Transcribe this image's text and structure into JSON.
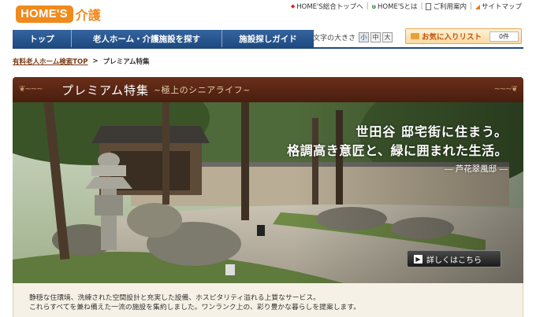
{
  "header": {
    "logo_home": "HOME'S",
    "logo_kaigo": "介護",
    "links": [
      "HOME'S総合トップへ",
      "HOME'Sとは",
      "ご利用案内",
      "サイトマップ"
    ]
  },
  "nav": {
    "items": [
      "トップ",
      "老人ホーム・介護施設を探す",
      "施設探しガイド"
    ],
    "font_size_label": "文字の大きさ",
    "font_sizes": [
      "小",
      "中",
      "大"
    ],
    "favorites_label": "お気に入りリスト",
    "favorites_count": "0件"
  },
  "breadcrumb": {
    "link": "有料老人ホーム検索TOP",
    "separator": ">",
    "current": "プレミアム特集"
  },
  "banner": {
    "title": "プレミアム特集",
    "subtitle": "~極上のシニアライフ~",
    "headline_1": "世田谷 邸宅街に住まう。",
    "headline_2": "格調高き意匠と、緑に囲まれた生活。",
    "facility": "― 芦花翠風邸 ―",
    "detail_button": "詳しくはこちら"
  },
  "description": {
    "line_1": "静穏な住環境、洗練された空間設計と充実した設備、ホスピタリティ溢れる上質なサービス。",
    "line_2": "これらすべてを兼ね備えた一流の施設を集約しました。ワンランク上の、彩り豊かな暮らしを提案します。"
  },
  "colors": {
    "brand_orange": "#f08a1e",
    "nav_blue": "#1f4a80",
    "banner_brown": "#5a2614"
  }
}
